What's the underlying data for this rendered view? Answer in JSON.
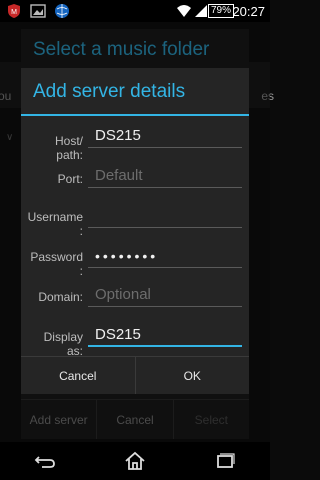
{
  "status_bar": {
    "time": "20:27",
    "battery": "79%",
    "icons": [
      "mcafee-icon",
      "gallery-icon",
      "globe-icon",
      "wifi-icon",
      "signal-icon",
      "battery-icon"
    ]
  },
  "background": {
    "dialog_title": "Select a music folder",
    "tab_left": "ou",
    "tab_right": "es",
    "buttons": [
      "Add server",
      "Cancel",
      "Select"
    ]
  },
  "dialog": {
    "title": "Add server details",
    "fields": {
      "host": {
        "label": "Host/\npath:",
        "value": "DS215",
        "placeholder": ""
      },
      "port": {
        "label": "Port:",
        "value": "",
        "placeholder": "Default"
      },
      "username": {
        "label": "Username\n:",
        "value": "",
        "placeholder": ""
      },
      "password": {
        "label": "Password\n:",
        "value": "••••••••",
        "placeholder": ""
      },
      "domain": {
        "label": "Domain:",
        "value": "",
        "placeholder": "Optional"
      },
      "display": {
        "label": "Display\nas:",
        "value": "DS215",
        "placeholder": ""
      }
    },
    "cancel_label": "Cancel",
    "ok_label": "OK"
  },
  "colors": {
    "accent": "#33b5e5",
    "dialog_bg": "#252525"
  }
}
